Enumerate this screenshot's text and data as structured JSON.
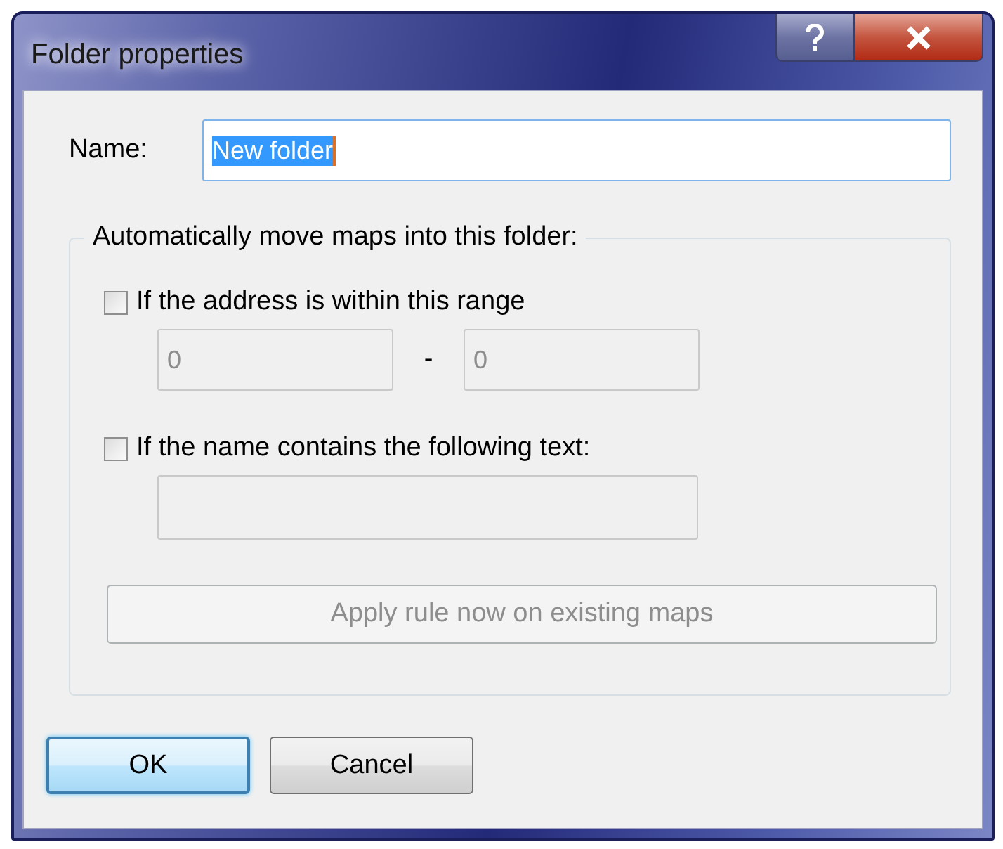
{
  "window": {
    "title": "Folder properties"
  },
  "name_field": {
    "label": "Name:",
    "value": "New folder",
    "text_selected": true
  },
  "group": {
    "title": "Automatically move maps into this folder:",
    "rules": [
      {
        "kind": "range",
        "label": "If the address is within this range",
        "checked": false,
        "from": "0",
        "separator": "-",
        "to": "0"
      },
      {
        "kind": "text",
        "label": "If the name contains the following text:",
        "checked": false
      }
    ],
    "apply_button": {
      "label": "Apply rule now on existing maps",
      "disabled": true
    }
  },
  "buttons": [
    {
      "label": "OK",
      "default": true
    },
    {
      "label": "Cancel",
      "default": false
    }
  ]
}
